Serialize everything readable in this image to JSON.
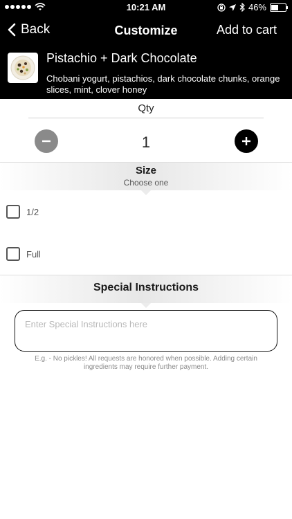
{
  "status_bar": {
    "time": "10:21 AM",
    "battery_percent": "46%",
    "icons": [
      "signal-dots-icon",
      "wifi-icon",
      "lock-rotation-icon",
      "location-arrow-icon",
      "bluetooth-icon",
      "battery-icon"
    ]
  },
  "nav": {
    "back_label": "Back",
    "title": "Customize",
    "add_to_cart_label": "Add to cart"
  },
  "product": {
    "name": "Pistachio + Dark Chocolate",
    "description": "Chobani yogurt, pistachios, dark chocolate chunks, orange slices, mint, clover honey"
  },
  "quantity": {
    "label": "Qty",
    "value": "1"
  },
  "size": {
    "title": "Size",
    "subtitle": "Choose one",
    "options": [
      {
        "label": "1/2",
        "checked": false
      },
      {
        "label": "Full",
        "checked": false
      }
    ]
  },
  "special_instructions": {
    "title": "Special Instructions",
    "placeholder": "Enter Special Instructions here",
    "value": "",
    "hint": "E.g. - No pickles! All requests are honored when possible. Adding certain ingredients may require further payment."
  },
  "colors": {
    "header_bg": "#000000",
    "minus_button": "#8a8a8a",
    "plus_button": "#000000"
  }
}
